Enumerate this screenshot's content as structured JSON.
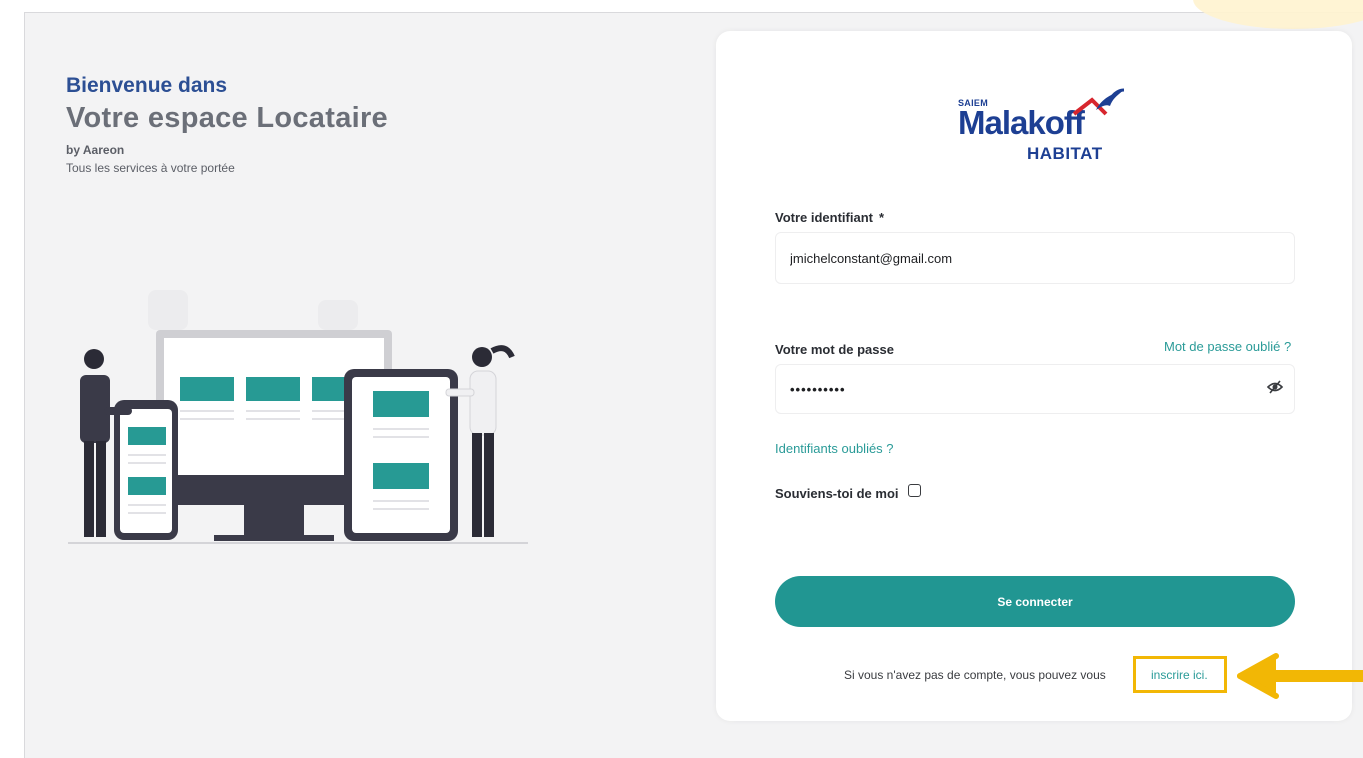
{
  "welcome": {
    "line1": "Bienvenue dans",
    "line2": "Votre espace Locataire",
    "by": "by Aareon",
    "tagline": "Tous les services à votre portée"
  },
  "brand": {
    "prefix": "SAIEM",
    "name": "Malakoff",
    "sub": "HABITAT",
    "logo_icon": "bird-roof-icon"
  },
  "form": {
    "identifier_label": "Votre identifiant",
    "required_marker": "*",
    "identifier_value": "jmichelconstant@gmail.com",
    "password_label": "Votre mot de passe",
    "forgot_password": "Mot de passe oublié ?",
    "password_value": "••••••••••",
    "eye_icon": "eye-slash-icon",
    "forgot_identifiers": "Identifiants oubliés ?",
    "remember_label": "Souviens-toi de moi",
    "remember_checked": false,
    "submit_label": "Se connecter",
    "signup_prefix": "Si vous n'avez pas de compte, vous pouvez vous",
    "signup_link": "inscrire ici."
  },
  "colors": {
    "accent_teal": "#219692",
    "link_teal": "#2a9b98",
    "brand_blue": "#1d3f93",
    "heading_blue": "#2c4f94",
    "highlight_yellow": "#f2b705",
    "roof_red": "#d7262e"
  },
  "annotation": {
    "highlight": "highlight-box",
    "pointer": "arrow-left-icon"
  }
}
